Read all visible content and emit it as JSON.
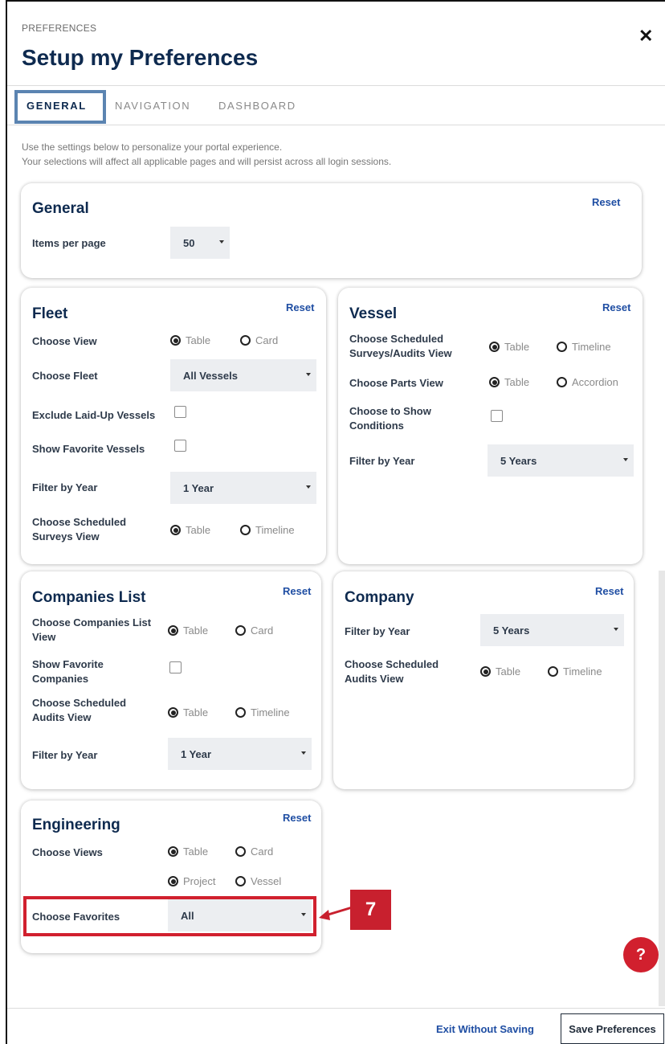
{
  "header": {
    "eyebrow": "PREFERENCES",
    "title": "Setup my Preferences",
    "close_glyph": "✕"
  },
  "tabs": [
    {
      "label": "GENERAL",
      "active": true
    },
    {
      "label": "NAVIGATION",
      "active": false
    },
    {
      "label": "DASHBOARD",
      "active": false
    }
  ],
  "intro": [
    "Use the settings below to personalize your portal experience.",
    "Your selections will affect all applicable pages and will persist across all login sessions."
  ],
  "reset_label": "Reset",
  "general": {
    "title": "General",
    "items_per_page_label": "Items per page",
    "items_per_page_value": "50"
  },
  "fleet": {
    "title": "Fleet",
    "choose_view_label": "Choose View",
    "choose_view_options": [
      "Table",
      "Card"
    ],
    "choose_fleet_label": "Choose Fleet",
    "choose_fleet_value": "All Vessels",
    "exclude_laid_up_label": "Exclude Laid-Up Vessels",
    "show_favorite_vessels_label": "Show Favorite Vessels",
    "filter_by_year_label": "Filter by Year",
    "filter_by_year_value": "1 Year",
    "scheduled_surveys_label": "Choose Scheduled Surveys View",
    "scheduled_surveys_options": [
      "Table",
      "Timeline"
    ]
  },
  "vessel": {
    "title": "Vessel",
    "scheduled_label": "Choose Scheduled Surveys/Audits View",
    "scheduled_options": [
      "Table",
      "Timeline"
    ],
    "parts_label": "Choose Parts View",
    "parts_options": [
      "Table",
      "Accordion"
    ],
    "conditions_label": "Choose to Show Conditions",
    "filter_by_year_label": "Filter by Year",
    "filter_by_year_value": "5 Years"
  },
  "companies_list": {
    "title": "Companies List",
    "view_label": "Choose Companies List View",
    "view_options": [
      "Table",
      "Card"
    ],
    "favorites_label": "Show Favorite Companies",
    "audits_label": "Choose Scheduled Audits View",
    "audits_options": [
      "Table",
      "Timeline"
    ],
    "filter_by_year_label": "Filter by Year",
    "filter_by_year_value": "1 Year"
  },
  "company": {
    "title": "Company",
    "filter_by_year_label": "Filter by Year",
    "filter_by_year_value": "5 Years",
    "audits_label": "Choose Scheduled Audits View",
    "audits_options": [
      "Table",
      "Timeline"
    ]
  },
  "engineering": {
    "title": "Engineering",
    "views_label": "Choose Views",
    "views_options_1": [
      "Table",
      "Card"
    ],
    "views_options_2": [
      "Project",
      "Vessel"
    ],
    "favorites_label": "Choose Favorites",
    "favorites_value": "All"
  },
  "callout": {
    "number": "7",
    "color": "#c8202e"
  },
  "footer": {
    "exit_label": "Exit Without Saving",
    "save_label": "Save Preferences",
    "help_glyph": "?"
  },
  "colors": {
    "brand_navy": "#0e2a4f",
    "link_blue": "#1f4ea3",
    "highlight_red": "#d1202e",
    "tab_outline": "#5b84b1"
  }
}
